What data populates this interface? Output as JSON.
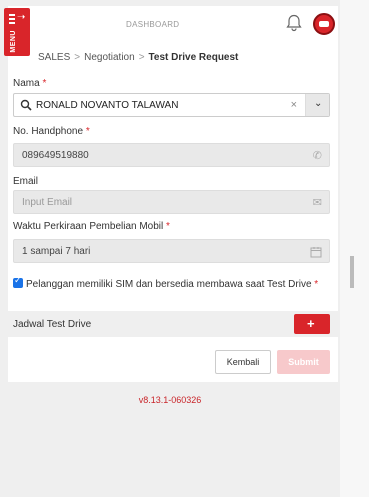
{
  "header": {
    "menu_label": "MENU",
    "title": "DASHBOARD",
    "icons": [
      "menu-icon",
      "bell-icon",
      "avatar-car-icon"
    ]
  },
  "breadcrumb": {
    "items": [
      "SALES",
      "Negotiation"
    ],
    "current": "Test Drive Request"
  },
  "form": {
    "nama": {
      "label": "Nama",
      "required": "*",
      "value": "RONALD NOVANTO TALAWAN",
      "clear": "×",
      "dropdown": "⌄"
    },
    "phone": {
      "label": "No. Handphone",
      "required": "*",
      "value": "089649519880",
      "icon": "phone-icon"
    },
    "email": {
      "label": "Email",
      "placeholder": "Input Email",
      "icon": "envelope-icon"
    },
    "waktu": {
      "label": "Waktu Perkiraan Pembelian Mobil",
      "required": "*",
      "value": "1 sampai 7 hari",
      "icon": "calendar-icon"
    },
    "sim_check": {
      "label": "Pelanggan memiliki SIM dan bersedia membawa saat Test Drive",
      "required": "*",
      "checked": true
    },
    "jadwal": {
      "label": "Jadwal Test Drive",
      "add": "+"
    }
  },
  "actions": {
    "back": "Kembali",
    "submit": "Submit"
  },
  "footer": {
    "version": "v8.13.1-060326"
  },
  "colors": {
    "brand": "#d9252a",
    "submit_disabled": "#f7c9cb",
    "checkbox": "#1a73e8"
  }
}
